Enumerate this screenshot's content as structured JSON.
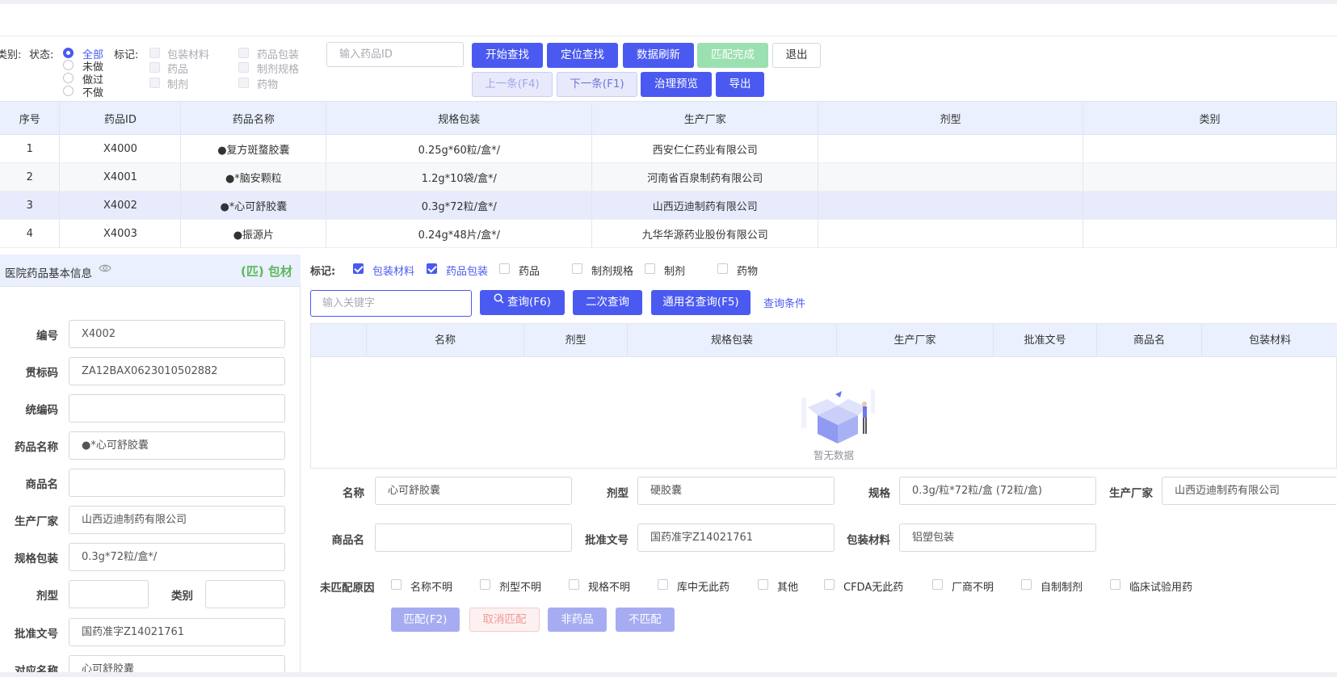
{
  "filter": {
    "category_label": "类别:",
    "status_label": "状态:",
    "status_options": [
      "全部",
      "未做",
      "做过",
      "不做"
    ],
    "mark_label": "标记:",
    "mark_options": [
      "包装材料",
      "药品包装",
      "药品",
      "制剂规格",
      "制剂",
      "药物"
    ],
    "drug_id_placeholder": "输入药品ID",
    "buttons_row1": [
      "开始查找",
      "定位查找",
      "数据刷新",
      "匹配完成",
      "退出"
    ],
    "buttons_row2": [
      "上一条(F4)",
      "下一条(F1)",
      "治理预览",
      "导出"
    ]
  },
  "main_table": {
    "headers": [
      "序号",
      "药品ID",
      "药品名称",
      "规格包装",
      "生产厂家",
      "剂型",
      "类别"
    ],
    "rows": [
      [
        "1",
        "X4000",
        "●复方斑蝥胶囊",
        "0.25g*60粒/盒*/",
        "西安仁仁药业有限公司",
        "",
        ""
      ],
      [
        "2",
        "X4001",
        "●*脑安颗粒",
        "1.2g*10袋/盒*/",
        "河南省百泉制药有限公司",
        "",
        ""
      ],
      [
        "3",
        "X4002",
        "●*心可舒胶囊",
        "0.3g*72粒/盒*/",
        "山西迈迪制药有限公司",
        "",
        ""
      ],
      [
        "4",
        "X4003",
        "●振源片",
        "0.24g*48片/盒*/",
        "九华华源药业股份有限公司",
        "",
        ""
      ]
    ],
    "selected_index": 2
  },
  "left_panel": {
    "title": "医院药品基本信息",
    "badge": "(匹) 包材",
    "fields": [
      {
        "label": "编号",
        "value": "X4002"
      },
      {
        "label": "贯标码",
        "value": "ZA12BAX0623010502882"
      },
      {
        "label": "统编码",
        "value": ""
      },
      {
        "label": "药品名称",
        "value": "●*心可舒胶囊"
      },
      {
        "label": "商品名",
        "value": ""
      },
      {
        "label": "生产厂家",
        "value": "山西迈迪制药有限公司"
      },
      {
        "label": "规格包装",
        "value": "0.3g*72粒/盒*/"
      }
    ],
    "dosage_label": "剂型",
    "dosage_value": "",
    "category_label": "类别",
    "category_value": "",
    "approval_label": "批准文号",
    "approval_value": "国药准字Z14021761",
    "match_name_label": "对应名称",
    "match_name_value": "心可舒胶囊"
  },
  "right_panel": {
    "mark_label": "标记:",
    "marks": [
      {
        "label": "包装材料",
        "checked": true
      },
      {
        "label": "药品包装",
        "checked": true
      },
      {
        "label": "药品",
        "checked": false
      },
      {
        "label": "制剂规格",
        "checked": false
      },
      {
        "label": "制剂",
        "checked": false
      },
      {
        "label": "药物",
        "checked": false
      }
    ],
    "keyword_placeholder": "输入关键字",
    "query_button": "查询(F6)",
    "second_query_button": "二次查询",
    "generic_query_button": "通用名查询(F5)",
    "query_condition_link": "查询条件",
    "sub_table_headers": [
      "名称",
      "剂型",
      "规格包装",
      "生产厂家",
      "批准文号",
      "商品名",
      "包装材料"
    ],
    "empty_text": "暂无数据",
    "form": {
      "name_label": "名称",
      "name_value": "心可舒胶囊",
      "dosage_label": "剂型",
      "dosage_value": "硬胶囊",
      "spec_label": "规格",
      "spec_value": "0.3g/粒*72粒/盒 (72粒/盒)",
      "maker_label": "生产厂家",
      "maker_value": "山西迈迪制药有限公司",
      "trade_label": "商品名",
      "trade_value": "",
      "approval_label": "批准文号",
      "approval_value": "国药准字Z14021761",
      "pack_label": "包装材料",
      "pack_value": "铝塑包装"
    },
    "unmatched_label": "未匹配原因",
    "unmatched_reasons": [
      "名称不明",
      "剂型不明",
      "规格不明",
      "库中无此药",
      "其他",
      "CFDA无此药",
      "厂商不明",
      "自制制剂",
      "临床试验用药"
    ],
    "action_buttons": [
      "匹配(F2)",
      "取消匹配",
      "非药品",
      "不匹配"
    ]
  },
  "colors": {
    "primary": "#4a5af0",
    "header_bg": "#eaf0fd",
    "success": "#5cb85c"
  }
}
